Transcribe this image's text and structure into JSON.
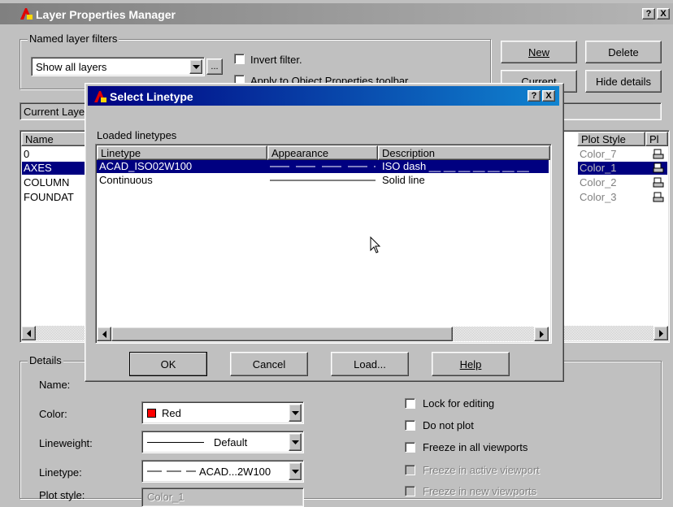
{
  "main_window": {
    "title": "Layer Properties Manager",
    "help_btn": "?",
    "close_btn": "X",
    "filters_group_label": "Named layer filters",
    "filter_value": "Show all layers",
    "filter_browse": "...",
    "invert_filter_label": "Invert filter.",
    "apply_toolbar_label": "Apply to Object Properties toolbar.",
    "new_btn": "New",
    "delete_btn": "Delete",
    "current_btn": "Current",
    "hide_details_btn": "Hide details",
    "current_layer_label": "Current Layer: AXES",
    "columns": {
      "name": "Name",
      "plot_style": "Plot Style",
      "plot": "Pl"
    },
    "layers": [
      {
        "name": "0",
        "plot_style": "Color_7"
      },
      {
        "name": "AXES",
        "plot_style": "Color_1"
      },
      {
        "name": "COLUMN",
        "plot_style": "Color_2"
      },
      {
        "name": "FOUNDAT",
        "plot_style": "Color_3"
      }
    ],
    "details": {
      "group_label": "Details",
      "name_label": "Name:",
      "color_label": "Color:",
      "color_value": "Red",
      "color_swatch": "#ff0000",
      "lineweight_label": "Lineweight:",
      "lineweight_value": "Default",
      "linetype_label": "Linetype:",
      "linetype_value": "ACAD...2W100",
      "plot_style_label": "Plot style:",
      "plot_style_value": "Color_1",
      "lock_label": "Lock for editing",
      "no_plot_label": "Do not plot",
      "freeze_all_label": "Freeze in all viewports",
      "freeze_active_label": "Freeze in active viewport",
      "freeze_new_label": "Freeze in new viewports"
    }
  },
  "dialog": {
    "title": "Select Linetype",
    "help_btn": "?",
    "close_btn": "X",
    "loaded_label": "Loaded linetypes",
    "columns": [
      "Linetype",
      "Appearance",
      "Description"
    ],
    "rows": [
      {
        "linetype": "ACAD_ISO02W100",
        "description": "ISO dash __ __ __ __ __ __ __",
        "selected": true
      },
      {
        "linetype": "Continuous",
        "description": "Solid line",
        "selected": false
      }
    ],
    "ok_btn": "OK",
    "cancel_btn": "Cancel",
    "load_btn": "Load...",
    "help_label_btn": "Help"
  }
}
